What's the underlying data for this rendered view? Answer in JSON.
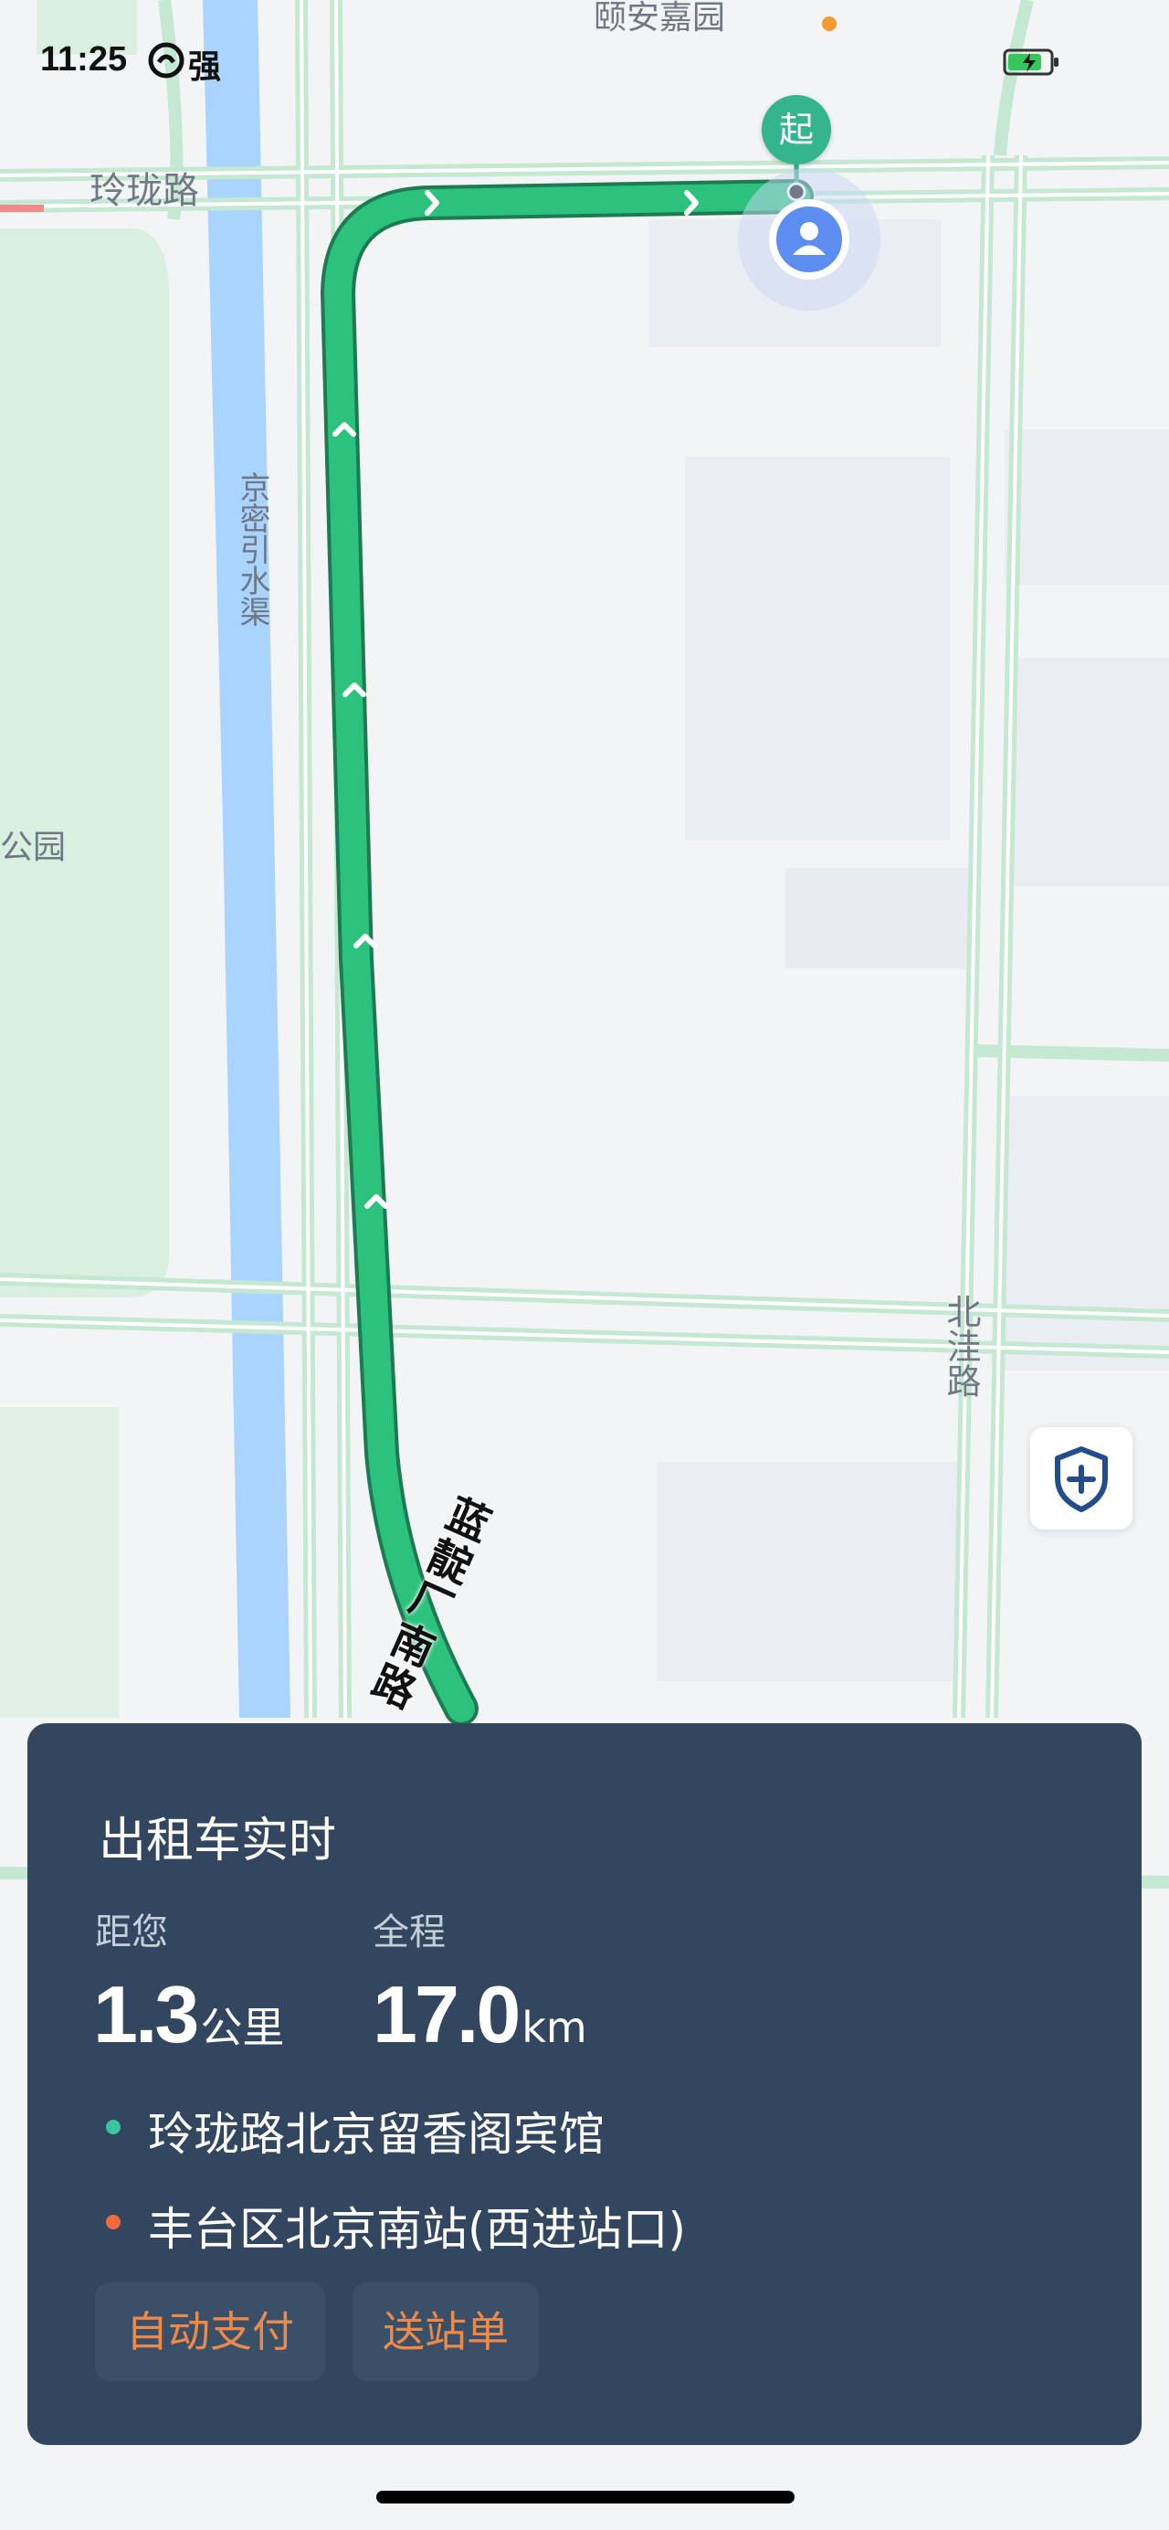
{
  "status_bar": {
    "time": "11:25",
    "carrier": "强"
  },
  "map": {
    "labels": {
      "top_area": "颐安嘉园",
      "road_linglong": "玲珑路",
      "canal": "京密引水渠",
      "park": "公园",
      "road_beiwa": "北洼路",
      "route_road": "蓝靛厂南路"
    },
    "start_marker": "起",
    "colors": {
      "route": "#2cc17c",
      "canal": "#a9d4ff",
      "park": "#d9efe0"
    }
  },
  "card": {
    "title": "出租车实时",
    "distance_label": "距您",
    "distance_value": "1.3",
    "distance_unit": "公里",
    "total_label": "全程",
    "total_value": "17.0",
    "total_unit": "km",
    "origin": "玲珑路北京留香阁宾馆",
    "destination": "丰台区北京南站(西进站口)",
    "buttons": {
      "auto_pay": "自动支付",
      "send_ticket": "送站单"
    }
  }
}
